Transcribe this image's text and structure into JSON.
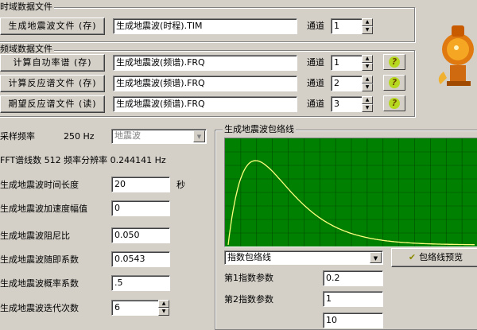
{
  "time_domain": {
    "title": "时域数据文件",
    "save_button": "生成地震波文件 (存)",
    "file": "生成地震波(时程).TIM",
    "channel_label": "通道",
    "channel": "1"
  },
  "freq_domain": {
    "title": "频域数据文件",
    "rows": [
      {
        "button": "计算自功率谱 (存)",
        "file": "生成地震波(频谱).FRQ",
        "channel_label": "通道",
        "channel": "1"
      },
      {
        "button": "计算反应谱文件 (存)",
        "file": "生成地震波(频谱).FRQ",
        "channel_label": "通道",
        "channel": "2"
      },
      {
        "button": "期望反应谱文件 (读)",
        "file": "生成地震波(频谱).FRQ",
        "channel_label": "通道",
        "channel": "3"
      }
    ],
    "help_glyph": "?"
  },
  "params": {
    "sample_rate_label": "采样频率",
    "sample_rate_value": "250 Hz",
    "wave_type": "地震波",
    "fft_info": "FFT谱线数 512 频率分辨率 0.244141 Hz",
    "fields": [
      {
        "label": "生成地震波时间长度",
        "value": "20",
        "unit": "秒"
      },
      {
        "label": "生成地震波加速度幅值",
        "value": "0",
        "unit": ""
      },
      {
        "label": "生成地震波阻尼比",
        "value": "0.050",
        "unit": ""
      },
      {
        "label": "生成地震波随即系数",
        "value": "0.0543",
        "unit": ""
      },
      {
        "label": "生成地震波概率系数",
        "value": ".5",
        "unit": ""
      },
      {
        "label": "生成地震波迭代次数",
        "value": "6",
        "unit": ""
      }
    ]
  },
  "envelope": {
    "title": "生成地震波包络线",
    "type_select": "指数包络线",
    "preview_button": "包络线预览",
    "param1_label": "第1指数参数",
    "param1_value": "0.2",
    "param2_label": "第2指数参数",
    "param2_value": "1",
    "param3_value": "10"
  },
  "colors": {
    "plot_bg": "#008000",
    "curve": "#ffff80",
    "grid": "#004d00"
  }
}
